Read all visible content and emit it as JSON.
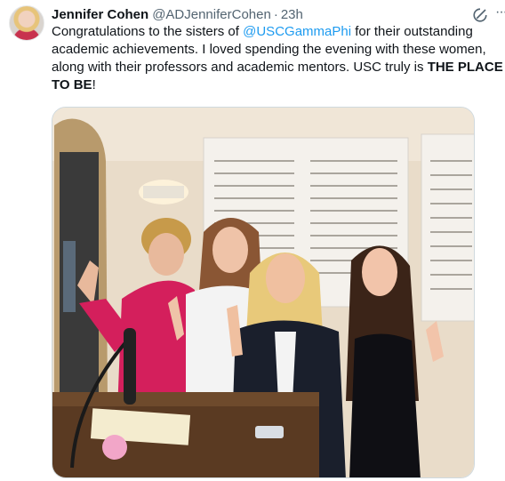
{
  "tweet": {
    "author_name": "Jennifer Cohen",
    "handle": "@ADJenniferCohen",
    "separator": "·",
    "time": "23h",
    "text_part1": "Congratulations to the sisters of ",
    "mention": "@USCGammaPhi",
    "text_part2": " for their outstanding academic achievements. I loved spending the evening with these women, along with their professors and academic mentors. USC truly is ",
    "emphasis": "THE PLACE TO BE",
    "text_end": "!"
  },
  "icons": {
    "grok": "grok-icon",
    "more": "more-icon"
  },
  "more_glyph": "···",
  "photo": {
    "description_icon": "photo"
  }
}
